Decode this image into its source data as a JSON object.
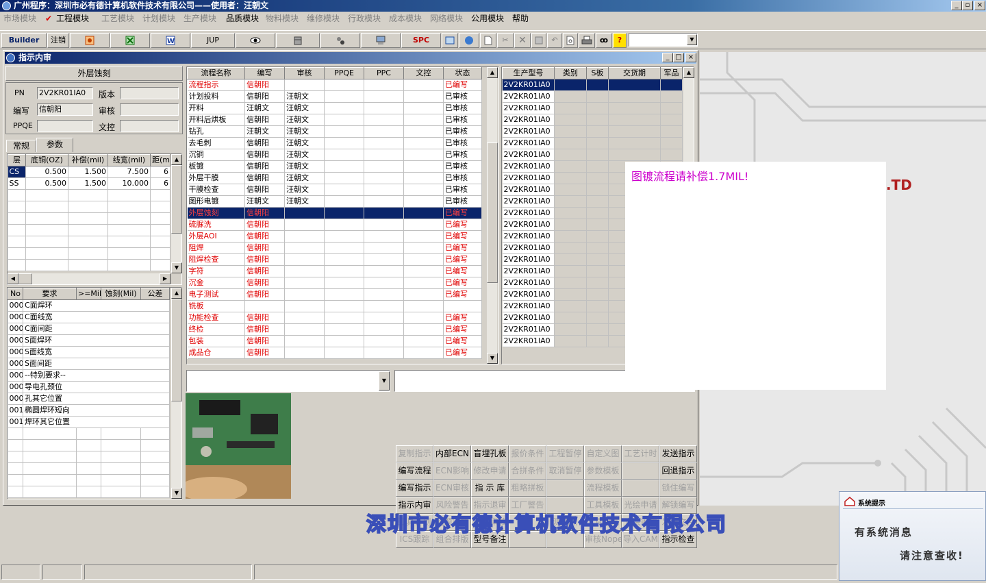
{
  "window": {
    "title": "广州程序：深圳市必有德计算机软件技术有限公司——使用者：汪朝文"
  },
  "menu": [
    {
      "label": "市场模块",
      "enabled": false
    },
    {
      "label": "工程模块",
      "enabled": true,
      "checked": true
    },
    {
      "label": "工艺模块",
      "enabled": false
    },
    {
      "label": "计划模块",
      "enabled": false
    },
    {
      "label": "生产模块",
      "enabled": false
    },
    {
      "label": "品质模块",
      "enabled": true
    },
    {
      "label": "物料模块",
      "enabled": false
    },
    {
      "label": "维修模块",
      "enabled": false
    },
    {
      "label": "行政模块",
      "enabled": false
    },
    {
      "label": "成本模块",
      "enabled": false
    },
    {
      "label": "网络模块",
      "enabled": false
    },
    {
      "label": "公用模块",
      "enabled": true
    },
    {
      "label": "帮助",
      "enabled": true
    }
  ],
  "toolbar": {
    "builder": "Builder",
    "logout": "注销",
    "jup": "JUP",
    "spc": "SPC",
    "help_glyph": "?"
  },
  "child": {
    "title": "指示内审"
  },
  "left": {
    "process_name": "外层蚀刻",
    "pn_label": "PN",
    "pn_value": "2V2KR01IA0",
    "version_label": "版本",
    "author_label": "编写",
    "author_value": "信朝阳",
    "review_label": "审核",
    "ppqe_label": "PPQE",
    "doc_label": "文控",
    "tabs": [
      "常规",
      "参数"
    ],
    "param_headers": [
      "层",
      "底铜(OZ)",
      "补偿(mil)",
      "线宽(mil)",
      "距(mi"
    ],
    "param_rows": [
      [
        "CS",
        "0.500",
        "1.500",
        "7.500",
        "6"
      ],
      [
        "SS",
        "0.500",
        "1.500",
        "10.000",
        "6"
      ]
    ],
    "req_headers": [
      "No",
      "要求",
      ">=Mil",
      "蚀刻(Mil)",
      "公差"
    ],
    "req_rows": [
      [
        "000",
        "C面焊环"
      ],
      [
        "000",
        "C面线宽"
      ],
      [
        "000",
        "C面间距"
      ],
      [
        "000",
        "S面焊环"
      ],
      [
        "000",
        "S面线宽"
      ],
      [
        "000",
        "S面间距"
      ],
      [
        "000",
        "--特别要求--"
      ],
      [
        "000",
        "导电孔颈位"
      ],
      [
        "000",
        "孔其它位置"
      ],
      [
        "001",
        "椭圆焊环短向"
      ],
      [
        "001",
        "焊环其它位置"
      ]
    ]
  },
  "flow": {
    "headers": [
      "流程名称",
      "编写",
      "审核",
      "PPQE",
      "PPC",
      "文控",
      "状态"
    ],
    "rows": [
      [
        "流程指示",
        "信朝阳",
        "",
        "",
        "",
        "",
        "已编写",
        "red"
      ],
      [
        "计划投料",
        "信朝阳",
        "汪朝文",
        "",
        "",
        "",
        "已审核",
        ""
      ],
      [
        "开料",
        "汪朝文",
        "汪朝文",
        "",
        "",
        "",
        "已审核",
        ""
      ],
      [
        "开料后烘板",
        "信朝阳",
        "汪朝文",
        "",
        "",
        "",
        "已审核",
        ""
      ],
      [
        "钻孔",
        "汪朝文",
        "汪朝文",
        "",
        "",
        "",
        "已审核",
        ""
      ],
      [
        "去毛刺",
        "信朝阳",
        "汪朝文",
        "",
        "",
        "",
        "已审核",
        ""
      ],
      [
        "沉铜",
        "信朝阳",
        "汪朝文",
        "",
        "",
        "",
        "已审核",
        ""
      ],
      [
        "板镀",
        "信朝阳",
        "汪朝文",
        "",
        "",
        "",
        "已审核",
        ""
      ],
      [
        "外层干膜",
        "信朝阳",
        "汪朝文",
        "",
        "",
        "",
        "已审核",
        ""
      ],
      [
        "干膜检查",
        "信朝阳",
        "汪朝文",
        "",
        "",
        "",
        "已审核",
        ""
      ],
      [
        "图形电镀",
        "汪朝文",
        "汪朝文",
        "",
        "",
        "",
        "已审核",
        ""
      ],
      [
        "外层蚀刻",
        "信朝阳",
        "",
        "",
        "",
        "",
        "已编写",
        "sel"
      ],
      [
        "硫脲洗",
        "信朝阳",
        "",
        "",
        "",
        "",
        "已编写",
        "red"
      ],
      [
        "外层AOI",
        "信朝阳",
        "",
        "",
        "",
        "",
        "已编写",
        "red"
      ],
      [
        "阻焊",
        "信朝阳",
        "",
        "",
        "",
        "",
        "已编写",
        "red"
      ],
      [
        "阻焊检查",
        "信朝阳",
        "",
        "",
        "",
        "",
        "已编写",
        "red"
      ],
      [
        "字符",
        "信朝阳",
        "",
        "",
        "",
        "",
        "已编写",
        "red"
      ],
      [
        "沉金",
        "信朝阳",
        "",
        "",
        "",
        "",
        "已编写",
        "red"
      ],
      [
        "电子测试",
        "信朝阳",
        "",
        "",
        "",
        "",
        "已编写",
        "red"
      ],
      [
        "铣板",
        "",
        "",
        "",
        "",
        "",
        "",
        "red"
      ],
      [
        "功能检查",
        "信朝阳",
        "",
        "",
        "",
        "",
        "已编写",
        "red"
      ],
      [
        "终检",
        "信朝阳",
        "",
        "",
        "",
        "",
        "已编写",
        "red"
      ],
      [
        "包装",
        "信朝阳",
        "",
        "",
        "",
        "",
        "已编写",
        "red"
      ],
      [
        "成品仓",
        "信朝阳",
        "",
        "",
        "",
        "",
        "已编写",
        "red"
      ]
    ]
  },
  "model": {
    "headers": [
      "生产型号",
      "类别",
      "S板",
      "交货期",
      "军品"
    ],
    "value": "2V2KR01IA0",
    "count": 23
  },
  "message": {
    "text": "图镀流程请补偿1.7MIL!",
    "color": "#cc00cc"
  },
  "bg_fragment": ".TD",
  "buttons": [
    [
      [
        "复制指示",
        false
      ],
      [
        "内部ECN",
        true
      ],
      [
        "盲埋孔板",
        true
      ],
      [
        "报价条件",
        false
      ],
      [
        "工程暂停",
        false
      ],
      [
        "自定义图",
        false
      ],
      [
        "工艺计时",
        false
      ],
      [
        "发送指示",
        true
      ]
    ],
    [
      [
        "编写流程",
        true
      ],
      [
        "ECN影响",
        false
      ],
      [
        "修改申请",
        false
      ],
      [
        "合拼条件",
        false
      ],
      [
        "取消暂停",
        false
      ],
      [
        "参数模板",
        false
      ],
      [
        "",
        false
      ],
      [
        "回退指示",
        true
      ]
    ],
    [
      [
        "编写指示",
        true
      ],
      [
        "ECN审核",
        false
      ],
      [
        "指 示 库",
        true
      ],
      [
        "粗略拼板",
        false
      ],
      [
        "",
        false
      ],
      [
        "流程模板",
        false
      ],
      [
        "",
        false
      ],
      [
        "锁住编写",
        false
      ]
    ],
    [
      [
        "指示内审",
        true
      ],
      [
        "风险警告",
        false
      ],
      [
        "指示退审",
        false
      ],
      [
        "工厂警告",
        false
      ],
      [
        "",
        false
      ],
      [
        "工具模板",
        false
      ],
      [
        "光绘申请",
        false
      ],
      [
        "解锁编写",
        false
      ]
    ],
    [
      [
        "工具计划",
        false
      ],
      [
        "问题审核",
        false
      ],
      [
        "答案审核",
        false
      ],
      [
        "",
        false
      ],
      [
        "测试点",
        false
      ],
      [
        "工具完成",
        false
      ],
      [
        "光绘审核",
        false
      ],
      [
        "发送文控",
        false
      ]
    ],
    [
      [
        "ICS跟踪",
        false
      ],
      [
        "组合排版",
        false
      ],
      [
        "型号备注",
        true
      ],
      [
        "",
        false
      ],
      [
        "",
        false
      ],
      [
        "审核Nope",
        false
      ],
      [
        "导入CAM",
        false
      ],
      [
        "指示检查",
        true
      ]
    ]
  ],
  "footer": {
    "company": "深圳市必有德计算机软件技术有限公司"
  },
  "sysmsg": {
    "title": "系统提示",
    "line1": "有系统消息",
    "line2": "请注意查收!"
  },
  "colors": {
    "title_start": "#0a246a",
    "title_end": "#a6caf0",
    "selection": "#0a246a",
    "red_text": "#e00000",
    "footer_text": "#3a4fb8"
  }
}
